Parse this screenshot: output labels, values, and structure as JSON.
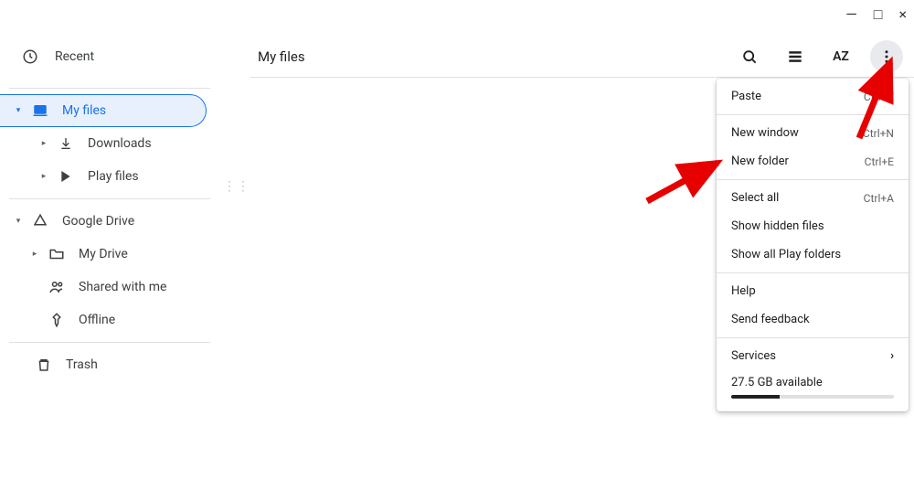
{
  "window": {
    "minimize": "—",
    "maximize": "□",
    "close": "×"
  },
  "recent": {
    "label": "Recent"
  },
  "header": {
    "title": "My files"
  },
  "sidebar": {
    "my_files": "My files",
    "downloads": "Downloads",
    "play_files": "Play files",
    "google_drive": "Google Drive",
    "my_drive": "My Drive",
    "shared": "Shared with me",
    "offline": "Offline",
    "trash": "Trash"
  },
  "menu": {
    "paste": {
      "label": "Paste",
      "shortcut": "Ctrl+V"
    },
    "new_window": {
      "label": "New window",
      "shortcut": "Ctrl+N"
    },
    "new_folder": {
      "label": "New folder",
      "shortcut": "Ctrl+E"
    },
    "select_all": {
      "label": "Select all",
      "shortcut": "Ctrl+A"
    },
    "show_hidden": {
      "label": "Show hidden files"
    },
    "show_play": {
      "label": "Show all Play folders"
    },
    "help": {
      "label": "Help"
    },
    "feedback": {
      "label": "Send feedback"
    },
    "services": {
      "label": "Services"
    },
    "storage": {
      "label": "27.5 GB available",
      "percent": 30
    }
  }
}
